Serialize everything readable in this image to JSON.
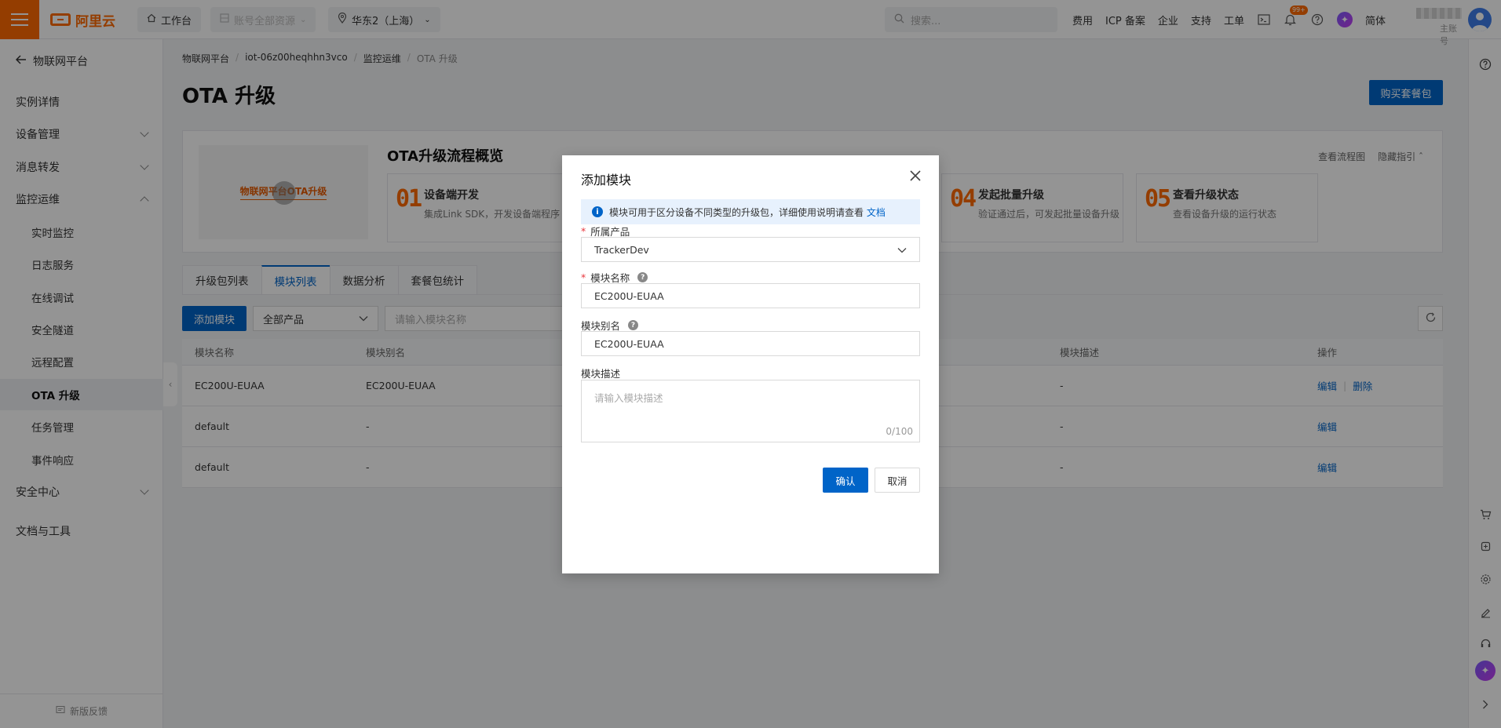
{
  "topbar": {
    "logo_text": "阿里云",
    "workbench": "工作台",
    "resources": "账号全部资源",
    "region": "华东2（上海）",
    "search_placeholder": "搜索...",
    "links": [
      "费用",
      "ICP 备案",
      "企业",
      "支持",
      "工单"
    ],
    "notification_badge": "99+",
    "language": "简体",
    "account_label": "主账号"
  },
  "sidebar": {
    "back_label": "物联网平台",
    "items": [
      {
        "label": "实例详情"
      },
      {
        "label": "设备管理"
      },
      {
        "label": "消息转发"
      },
      {
        "label": "监控运维"
      },
      {
        "label": "实时监控"
      },
      {
        "label": "日志服务"
      },
      {
        "label": "在线调试"
      },
      {
        "label": "安全隧道"
      },
      {
        "label": "远程配置"
      },
      {
        "label": "OTA 升级"
      },
      {
        "label": "任务管理"
      },
      {
        "label": "事件响应"
      },
      {
        "label": "安全中心"
      },
      {
        "label": "文档与工具"
      }
    ],
    "feedback": "新版反馈"
  },
  "breadcrumb": [
    "物联网平台",
    "iot-06z00heqhhn3vco",
    "监控运维",
    "OTA 升级"
  ],
  "page_title": "OTA 升级",
  "buy_button": "购买套餐包",
  "overview": {
    "video_caption": "物联网平台OTA升级",
    "title": "OTA升级流程概览",
    "link_flow": "查看流程图",
    "link_hide": "隐藏指引",
    "steps": [
      {
        "num": "01",
        "title": "设备端开发",
        "desc": "集成Link SDK，开发设备端程序"
      },
      {
        "num": "04",
        "title": "发起批量升级",
        "desc": "验证通过后，可发起批量设备升级"
      },
      {
        "num": "05",
        "title": "查看升级状态",
        "desc": "查看设备升级的运行状态"
      }
    ]
  },
  "tabs": [
    "升级包列表",
    "模块列表",
    "数据分析",
    "套餐包统计"
  ],
  "toolbar": {
    "add_button": "添加模块",
    "filter_value": "全部产品",
    "search_placeholder": "请输入模块名称"
  },
  "table": {
    "headers": {
      "name": "模块名称",
      "alias": "模块别名",
      "desc": "模块描述",
      "ops": "操作"
    },
    "rows": [
      {
        "name": "EC200U-EUAA",
        "alias": "EC200U-EUAA",
        "desc": "-",
        "edit": "编辑",
        "delete": "删除"
      },
      {
        "name": "default",
        "alias": "-",
        "desc": "-",
        "edit": "编辑"
      },
      {
        "name": "default",
        "alias": "-",
        "desc": "-",
        "edit": "编辑"
      }
    ]
  },
  "modal": {
    "title": "添加模块",
    "info_text": "模块可用于区分设备不同类型的升级包，详细使用说明请查看",
    "info_link": "文档",
    "product_label": "所属产品",
    "product_value": "TrackerDev",
    "name_label": "模块名称",
    "name_value": "EC200U-EUAA",
    "alias_label": "模块别名",
    "alias_value": "EC200U-EUAA",
    "desc_label": "模块描述",
    "desc_placeholder": "请输入模块描述",
    "desc_count": "0/100",
    "confirm": "确认",
    "cancel": "取消"
  },
  "colors": {
    "brand_orange": "#ff6a00",
    "primary_blue": "#0064c8"
  }
}
